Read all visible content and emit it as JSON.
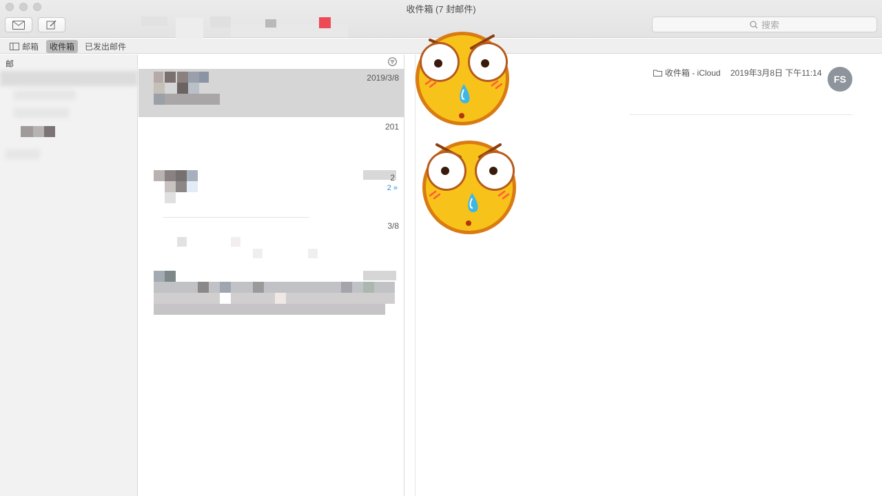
{
  "window": {
    "title": "收件箱 (7 封邮件)"
  },
  "toolbar": {
    "get_mail_icon": "envelope-icon",
    "compose_icon": "compose-icon",
    "search_placeholder": "搜索"
  },
  "favorites": {
    "mailboxes_label": "邮箱",
    "inbox_label": "收件箱",
    "sent_label": "已发出邮件"
  },
  "sidebar": {
    "header_fragment": "邮"
  },
  "message_list": {
    "filter_icon": "filter-icon",
    "messages": [
      {
        "date": "2019/3/8",
        "selected": true
      },
      {
        "date": "201",
        "selected": false
      },
      {
        "date": "2",
        "thread_count": "2 »",
        "selected": false
      },
      {
        "date": "3/8",
        "selected": false
      }
    ]
  },
  "reader": {
    "folder": "收件箱 - iCloud",
    "date": "2019年3月8日 下午11:14",
    "avatar_initials": "FS"
  },
  "colors": {
    "accent_blue": "#2a8fe3",
    "selected_row": "#d6d6d6",
    "avatar_bg": "#8e949c",
    "emoji_yellow": "#f7c21a",
    "emoji_outline": "#d97b12"
  }
}
